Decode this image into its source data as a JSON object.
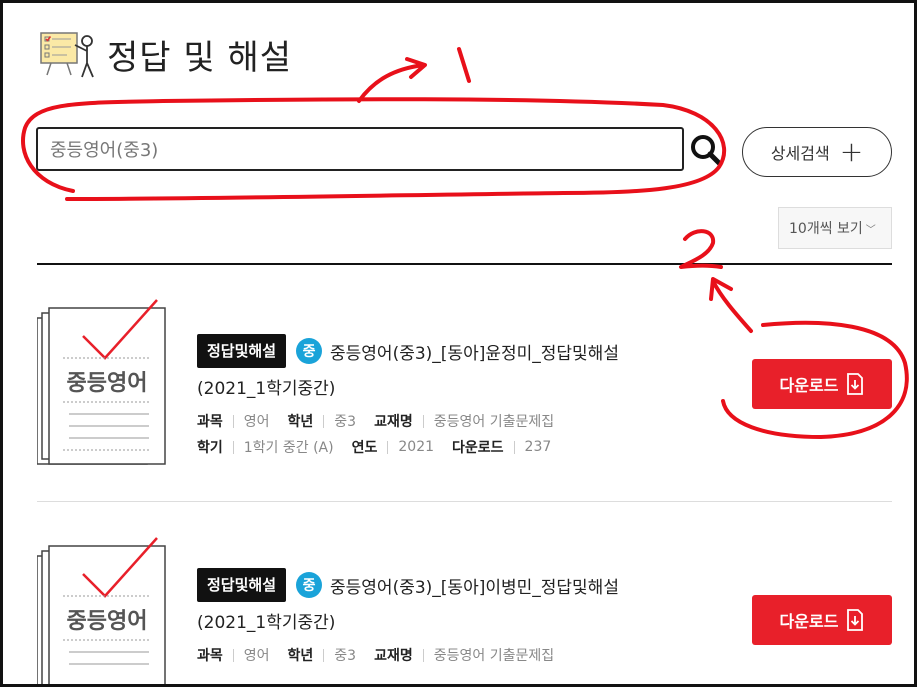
{
  "header": {
    "title": "정답 및 해설",
    "icon": "chalkboard-icon"
  },
  "search": {
    "value": "중등영어(중3)",
    "button_icon": "search-icon"
  },
  "detail_search": {
    "label": "상세검색",
    "icon": "plus-icon"
  },
  "per_page": {
    "label": "10개씩 보기"
  },
  "items": [
    {
      "thumb_label": "중등영어",
      "type_badge": "정답및해설",
      "level_badge": "중",
      "title": "중등영어(중3)_[동아]윤정미_정답및해설",
      "subtitle": "(2021_1학기중간)",
      "meta1": [
        {
          "key": "과목",
          "value": "영어"
        },
        {
          "key": "학년",
          "value": "중3"
        },
        {
          "key": "교재명",
          "value": "중등영어 기출문제집"
        }
      ],
      "meta2": [
        {
          "key": "학기",
          "value": "1학기 중간 (A)"
        },
        {
          "key": "연도",
          "value": "2021"
        },
        {
          "key": "다운로드",
          "value": "237"
        }
      ],
      "download_label": "다운로드"
    },
    {
      "thumb_label": "중등영어",
      "type_badge": "정답및해설",
      "level_badge": "중",
      "title": "중등영어(중3)_[동아]이병민_정답및해설",
      "subtitle": "(2021_1학기중간)",
      "meta1": [
        {
          "key": "과목",
          "value": "영어"
        },
        {
          "key": "학년",
          "value": "중3"
        },
        {
          "key": "교재명",
          "value": "중등영어 기출문제집"
        }
      ],
      "download_label": "다운로드"
    }
  ],
  "annotations": {
    "mark1": "1",
    "mark2": "2",
    "color": "#e8101a"
  },
  "colors": {
    "accent": "#e8202a",
    "level_badge": "#1aa3d9",
    "type_badge": "#111111"
  }
}
